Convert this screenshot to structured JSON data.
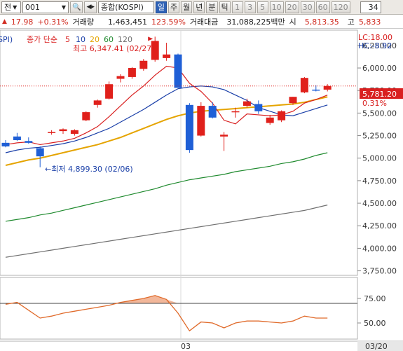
{
  "toolbar": {
    "market_label": "전",
    "code_value": "001",
    "name_value": "종합(KOSPI)",
    "periods": [
      "일",
      "주",
      "월",
      "년",
      "분",
      "틱"
    ],
    "active_period": "일",
    "intervals": [
      "1",
      "3",
      "5",
      "10",
      "20",
      "30",
      "60",
      "120"
    ],
    "count_value": "34"
  },
  "info": {
    "change": "17.98",
    "change_pct": "+0.31%",
    "volume_label": "거래량",
    "volume": "1,463,451",
    "volume_ratio": "123.59%",
    "amount_label": "거래대금",
    "amount": "31,088,225백만",
    "open_label": "시",
    "open": "5,813.35",
    "high_label": "고",
    "high": "5,833"
  },
  "chart": {
    "index_tag": "SPI)",
    "legend_title": "종가 단순",
    "ma_periods": [
      "5",
      "10",
      "20",
      "60",
      "120"
    ],
    "ma_colors": [
      "#d92020",
      "#1a3fa8",
      "#e5a400",
      "#1f8a2e",
      "#707070"
    ],
    "lc_label": "LC:18.00",
    "hc_label": "HC:-8.92",
    "high_annotation": "최고 6,347.41 (02/27)",
    "low_annotation": "←최저 4,899.30 (02/06)",
    "current_price": "5,781.20",
    "current_pct": "0.31%",
    "y_ticks": [
      "6,250.00",
      "6,000.00",
      "5,750.00",
      "5,500.00",
      "5,250.00",
      "5,000.00",
      "4,750.00",
      "4,500.00",
      "4,250.00",
      "4,000.00",
      "3,750.00"
    ],
    "osc_ticks": [
      "75.00",
      "50.00"
    ],
    "x_labels": [
      "03",
      "03/20"
    ]
  },
  "chart_data": {
    "type": "candlestick",
    "candles": [
      {
        "o": 5170,
        "h": 5200,
        "l": 5120,
        "c": 5130
      },
      {
        "o": 5240,
        "h": 5280,
        "l": 5190,
        "c": 5200
      },
      {
        "o": 5190,
        "h": 5230,
        "l": 5160,
        "c": 5170
      },
      {
        "o": 5110,
        "h": 5130,
        "l": 4899.3,
        "c": 5020
      },
      {
        "o": 5280,
        "h": 5310,
        "l": 5260,
        "c": 5290
      },
      {
        "o": 5300,
        "h": 5330,
        "l": 5270,
        "c": 5320
      },
      {
        "o": 5270,
        "h": 5320,
        "l": 5250,
        "c": 5310
      },
      {
        "o": 5420,
        "h": 5520,
        "l": 5410,
        "c": 5510
      },
      {
        "o": 5590,
        "h": 5650,
        "l": 5560,
        "c": 5640
      },
      {
        "o": 5660,
        "h": 5850,
        "l": 5650,
        "c": 5820
      },
      {
        "o": 5880,
        "h": 5930,
        "l": 5840,
        "c": 5910
      },
      {
        "o": 5900,
        "h": 6010,
        "l": 5880,
        "c": 6000
      },
      {
        "o": 5990,
        "h": 6100,
        "l": 5970,
        "c": 6080
      },
      {
        "o": 6090,
        "h": 6347.41,
        "l": 6070,
        "c": 6300
      },
      {
        "o": 6110,
        "h": 6280,
        "l": 6080,
        "c": 6150
      },
      {
        "o": 6150,
        "h": 6160,
        "l": 5780,
        "c": 5780
      },
      {
        "o": 5590,
        "h": 5610,
        "l": 5060,
        "c": 5090
      },
      {
        "o": 5250,
        "h": 5620,
        "l": 5240,
        "c": 5580
      },
      {
        "o": 5580,
        "h": 5620,
        "l": 5440,
        "c": 5450
      },
      {
        "o": 5240,
        "h": 5290,
        "l": 5080,
        "c": 5260
      },
      {
        "o": 5520,
        "h": 5560,
        "l": 5450,
        "c": 5520
      },
      {
        "o": 5580,
        "h": 5660,
        "l": 5560,
        "c": 5630
      },
      {
        "o": 5600,
        "h": 5640,
        "l": 5490,
        "c": 5520
      },
      {
        "o": 5390,
        "h": 5480,
        "l": 5370,
        "c": 5450
      },
      {
        "o": 5420,
        "h": 5530,
        "l": 5400,
        "c": 5520
      },
      {
        "o": 5610,
        "h": 5680,
        "l": 5590,
        "c": 5680
      },
      {
        "o": 5730,
        "h": 5900,
        "l": 5720,
        "c": 5890
      },
      {
        "o": 5760,
        "h": 5810,
        "l": 5740,
        "c": 5750
      },
      {
        "o": 5760,
        "h": 5820,
        "l": 5740,
        "c": 5800
      }
    ],
    "ma5": [
      5150,
      5170,
      5180,
      5150,
      5170,
      5190,
      5220,
      5280,
      5350,
      5460,
      5580,
      5700,
      5800,
      5920,
      6020,
      6000,
      5830,
      5740,
      5610,
      5420,
      5380,
      5490,
      5480,
      5470,
      5480,
      5520,
      5610,
      5650,
      5700
    ],
    "ma10": [
      5060,
      5090,
      5110,
      5120,
      5140,
      5160,
      5190,
      5230,
      5280,
      5330,
      5400,
      5470,
      5540,
      5620,
      5700,
      5770,
      5790,
      5800,
      5790,
      5760,
      5700,
      5640,
      5560,
      5520,
      5480,
      5470,
      5510,
      5550,
      5590
    ],
    "ma20": [
      4920,
      4950,
      4980,
      5000,
      5030,
      5060,
      5090,
      5120,
      5150,
      5190,
      5230,
      5280,
      5330,
      5380,
      5430,
      5470,
      5500,
      5520,
      5530,
      5540,
      5550,
      5560,
      5570,
      5580,
      5590,
      5600,
      5620,
      5650,
      5680
    ],
    "ma60": [
      4300,
      4320,
      4340,
      4370,
      4390,
      4420,
      4450,
      4480,
      4510,
      4540,
      4570,
      4600,
      4630,
      4660,
      4700,
      4730,
      4760,
      4780,
      4800,
      4820,
      4850,
      4870,
      4890,
      4910,
      4940,
      4960,
      4990,
      5030,
      5060
    ],
    "ma120": [
      3900,
      3920,
      3940,
      3960,
      3980,
      4000,
      4020,
      4040,
      4060,
      4080,
      4100,
      4120,
      4140,
      4160,
      4180,
      4200,
      4220,
      4240,
      4260,
      4280,
      4300,
      4320,
      4340,
      4360,
      4380,
      4400,
      4420,
      4450,
      4480
    ],
    "oscillator": [
      69,
      71,
      63,
      55,
      57,
      60,
      62,
      64,
      66,
      68,
      71,
      73,
      75,
      78,
      74,
      60,
      42,
      51,
      50,
      45,
      50,
      52,
      52,
      51,
      50,
      52,
      57,
      55,
      55
    ],
    "osc_level": 70,
    "ylim": [
      3700,
      6420
    ],
    "osc_ylim": [
      35,
      95
    ]
  }
}
